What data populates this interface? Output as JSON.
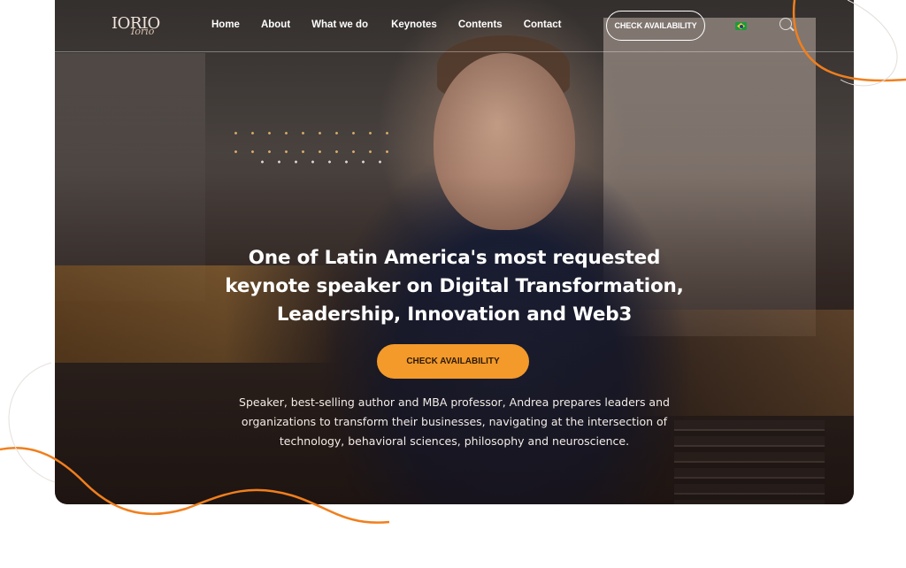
{
  "header": {
    "logo": {
      "main": "IORIO",
      "script": "Iorio"
    },
    "nav": [
      {
        "label": "Home"
      },
      {
        "label": "About"
      },
      {
        "label": "What we do"
      },
      {
        "label": "Keynotes"
      },
      {
        "label": "Contents"
      },
      {
        "label": "Contact"
      }
    ],
    "check_availability": "CHECK AVAILABILITY",
    "language_flag": "brazil-flag-icon",
    "search_icon": "search-icon"
  },
  "hero": {
    "headline": [
      "One of Latin America's most requested",
      "keynote speaker on Digital Transformation,",
      "Leadership, Innovation and Web3"
    ],
    "cta": "CHECK AVAILABILITY",
    "description": [
      "Speaker, best-selling author and MBA professor, Andrea prepares leaders and",
      "organizations to transform their businesses, navigating at the intersection of",
      "technology, behavioral sciences, philosophy and neuroscience."
    ]
  },
  "colors": {
    "accent": "#f39a2b",
    "curve": "#f07f1e",
    "text_light": "#ffffff"
  }
}
